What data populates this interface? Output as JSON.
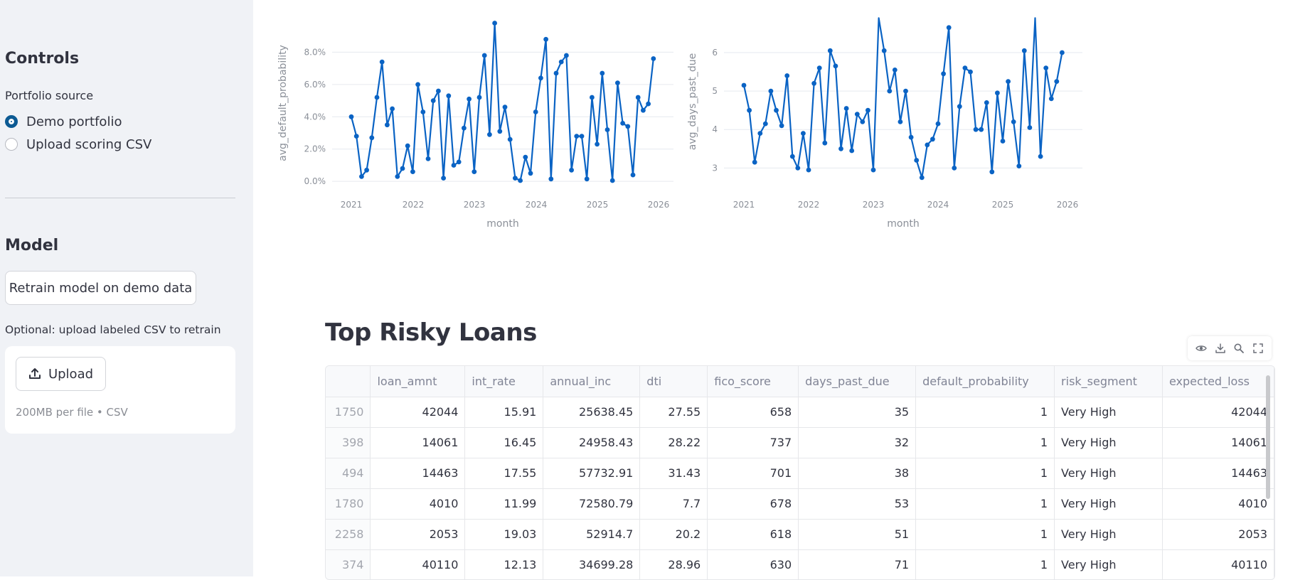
{
  "sidebar": {
    "controls_title": "Controls",
    "portfolio_source_label": "Portfolio source",
    "radio_options": [
      "Demo portfolio",
      "Upload scoring CSV"
    ],
    "selected_option": "Demo portfolio",
    "model_title": "Model",
    "retrain_button": "Retrain model on demo data",
    "upload_caption": "Optional: upload labeled CSV to retrain",
    "upload_button": "Upload",
    "upload_hint": "200MB per file • CSV"
  },
  "colors": {
    "accent": "#0c5a93",
    "line": "#0a63c4",
    "sidebar_bg": "#f0f2f6"
  },
  "chart_data": [
    {
      "type": "line",
      "xlabel": "month",
      "ylabel": "avg_default_probability",
      "x_ticks": [
        "2021",
        "2022",
        "2023",
        "2024",
        "2025",
        "2026"
      ],
      "y_ticks": [
        "0.0%",
        "2.0%",
        "4.0%",
        "6.0%",
        "8.0%"
      ],
      "ylim": [
        -0.3,
        10
      ],
      "x_start": "2021-01",
      "y_unit": "percent",
      "values": [
        4.0,
        2.8,
        0.3,
        0.7,
        2.7,
        5.2,
        7.4,
        3.5,
        4.5,
        0.3,
        0.8,
        2.2,
        0.6,
        6.0,
        4.3,
        1.4,
        5.0,
        5.6,
        0.2,
        5.3,
        1.0,
        1.2,
        3.3,
        5.1,
        0.6,
        5.2,
        7.8,
        2.9,
        9.8,
        3.1,
        4.6,
        2.6,
        0.2,
        0.05,
        1.5,
        0.5,
        4.3,
        6.4,
        8.8,
        0.15,
        6.7,
        7.4,
        7.8,
        0.7,
        2.8,
        2.8,
        0.15,
        5.2,
        2.3,
        6.7,
        3.2,
        0.05,
        6.1,
        3.6,
        3.4,
        0.4,
        5.2,
        4.4,
        4.8,
        7.6
      ]
    },
    {
      "type": "line",
      "xlabel": "month",
      "ylabel": "avg_days_past_due",
      "x_ticks": [
        "2021",
        "2022",
        "2023",
        "2024",
        "2025",
        "2026"
      ],
      "y_ticks": [
        "3",
        "4",
        "5",
        "6"
      ],
      "ylim": [
        2.6,
        6.85
      ],
      "x_start": "2021-01",
      "values": [
        5.15,
        4.5,
        3.15,
        3.9,
        4.15,
        5.0,
        4.5,
        4.1,
        5.4,
        3.3,
        3.0,
        3.9,
        2.95,
        5.2,
        5.6,
        3.65,
        6.05,
        5.65,
        3.5,
        4.55,
        3.45,
        4.4,
        4.2,
        4.5,
        2.95,
        6.9,
        6.05,
        5.0,
        5.55,
        4.2,
        5.0,
        3.8,
        3.2,
        2.75,
        3.6,
        3.75,
        4.15,
        5.45,
        6.65,
        3.0,
        4.6,
        5.6,
        5.5,
        4.0,
        4.0,
        4.7,
        2.9,
        4.95,
        3.7,
        5.25,
        4.2,
        3.05,
        6.05,
        4.05,
        6.9,
        3.3,
        5.6,
        4.8,
        5.25,
        6.0
      ]
    }
  ],
  "table": {
    "title": "Top Risky Loans",
    "columns": [
      "",
      "loan_amnt",
      "int_rate",
      "annual_inc",
      "dti",
      "fico_score",
      "days_past_due",
      "default_probability",
      "risk_segment",
      "expected_loss"
    ],
    "rows": [
      [
        "1750",
        "42044",
        "15.91",
        "25638.45",
        "27.55",
        "658",
        "35",
        "1",
        "Very High",
        "42044"
      ],
      [
        "398",
        "14061",
        "16.45",
        "24958.43",
        "28.22",
        "737",
        "32",
        "1",
        "Very High",
        "14061"
      ],
      [
        "494",
        "14463",
        "17.55",
        "57732.91",
        "31.43",
        "701",
        "38",
        "1",
        "Very High",
        "14463"
      ],
      [
        "1780",
        "4010",
        "11.99",
        "72580.79",
        "7.7",
        "678",
        "53",
        "1",
        "Very High",
        "4010"
      ],
      [
        "2258",
        "2053",
        "19.03",
        "52914.7",
        "20.2",
        "618",
        "51",
        "1",
        "Very High",
        "2053"
      ],
      [
        "374",
        "40110",
        "12.13",
        "34699.28",
        "28.96",
        "630",
        "71",
        "1",
        "Very High",
        "40110"
      ]
    ],
    "toolbar_icons": [
      "eye-icon",
      "download-icon",
      "search-icon",
      "fullscreen-icon"
    ]
  }
}
